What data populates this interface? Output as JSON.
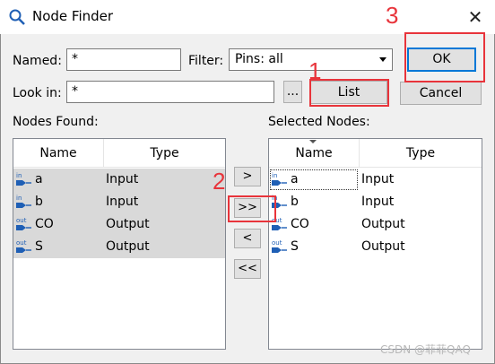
{
  "window": {
    "title": "Node Finder",
    "close_glyph": "✕"
  },
  "named": {
    "label": "Named:",
    "value": "*"
  },
  "filter": {
    "label": "Filter:",
    "value": "Pins: all"
  },
  "look_in": {
    "label": "Look in:",
    "value": "*",
    "browse_label": "..."
  },
  "buttons": {
    "ok": "OK",
    "list": "List",
    "cancel": "Cancel"
  },
  "nodes_found": {
    "label": "Nodes Found:",
    "columns": [
      "Name",
      "Type"
    ],
    "rows": [
      {
        "name": "a",
        "type": "Input",
        "icon": "input-pin-icon",
        "icon_text": "in"
      },
      {
        "name": "b",
        "type": "Input",
        "icon": "input-pin-icon",
        "icon_text": "in"
      },
      {
        "name": "CO",
        "type": "Output",
        "icon": "output-pin-icon",
        "icon_text": "out"
      },
      {
        "name": "S",
        "type": "Output",
        "icon": "output-pin-icon",
        "icon_text": "out"
      }
    ]
  },
  "selected_nodes": {
    "label": "Selected Nodes:",
    "columns": [
      "Name",
      "Type"
    ],
    "rows": [
      {
        "name": "a",
        "type": "Input",
        "icon": "input-pin-icon",
        "icon_text": "in"
      },
      {
        "name": "b",
        "type": "Input",
        "icon": "input-pin-icon",
        "icon_text": "in"
      },
      {
        "name": "CO",
        "type": "Output",
        "icon": "output-pin-icon",
        "icon_text": "out"
      },
      {
        "name": "S",
        "type": "Output",
        "icon": "output-pin-icon",
        "icon_text": "out"
      }
    ]
  },
  "move_buttons": {
    "add": ">",
    "add_all": ">>",
    "remove": "<",
    "remove_all": "<<"
  },
  "annotations": {
    "n1": "1",
    "n2": "2",
    "n3": "3",
    "color": "#e8343b"
  },
  "watermark": "CSDN @菲菲QAQ"
}
